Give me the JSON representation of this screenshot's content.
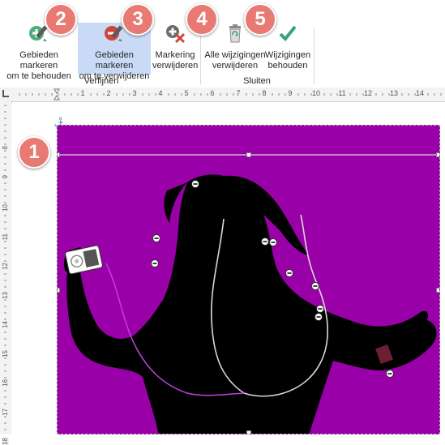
{
  "ribbon": {
    "buttons": [
      {
        "label": "Gebieden markeren\nom te behouden",
        "icon": "plus-pencil-icon"
      },
      {
        "label": "Gebieden markeren\nom te verwijderen",
        "icon": "minus-pencil-icon"
      },
      {
        "label": "Markering\nverwijderen",
        "icon": "eraser-cross-icon"
      },
      {
        "label": "Alle wijzigingen\nverwijderen",
        "icon": "trash-icon"
      },
      {
        "label": "Wijzigingen\nbehouden",
        "icon": "checkmark-icon"
      }
    ],
    "groups": [
      {
        "label": "Verfijnen"
      },
      {
        "label": "Sluiten"
      }
    ]
  },
  "callouts": [
    "1",
    "2",
    "3",
    "4",
    "5"
  ],
  "ruler": {
    "h_numbers": [
      "1",
      "2",
      "3",
      "4",
      "5",
      "6",
      "7",
      "8",
      "9",
      "10",
      "11",
      "12",
      "13",
      "14"
    ],
    "v_numbers": [
      "8",
      "9",
      "10",
      "11",
      "12",
      "13",
      "14",
      "15",
      "16",
      "17",
      "18"
    ]
  },
  "image": {
    "background_color": "#9a00a8",
    "subject": "silhouette-dancer-with-music-player"
  },
  "colors": {
    "selected_button": "#c8daf5",
    "callout": "#e87a73",
    "remove_marker": "#d0453a",
    "keep_marker": "#4caf7a",
    "checkmark": "#3aa37a"
  }
}
